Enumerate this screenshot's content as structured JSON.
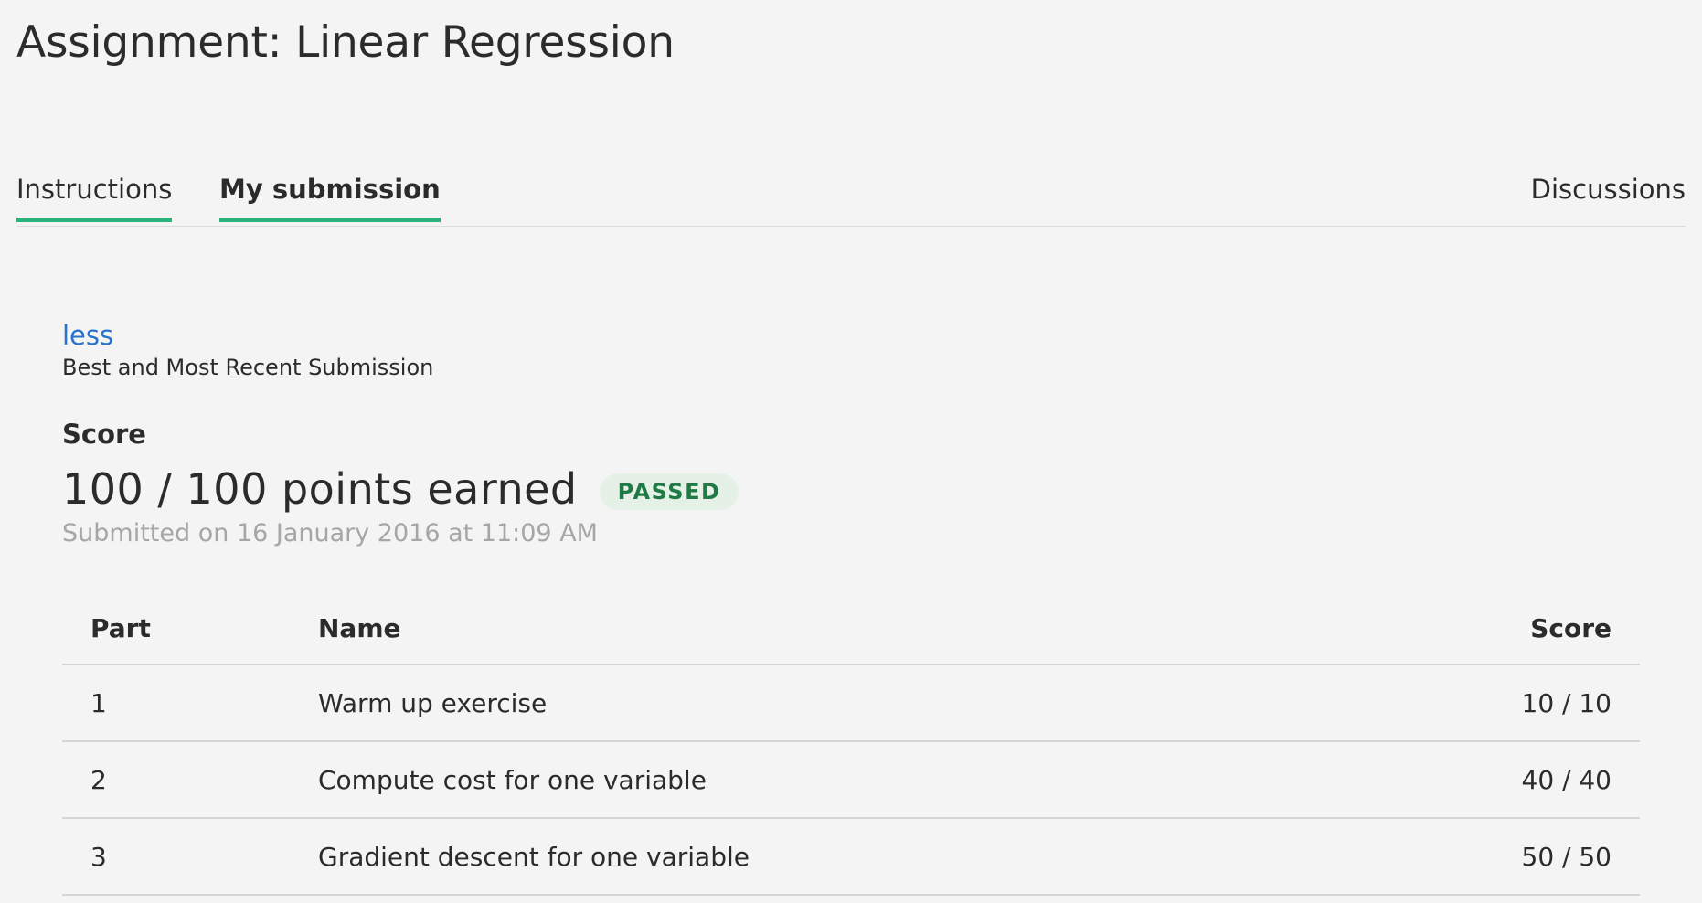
{
  "page": {
    "title": "Assignment: Linear Regression"
  },
  "tabs": [
    {
      "label": "Instructions"
    },
    {
      "label": "My submission"
    },
    {
      "label": "Discussions"
    }
  ],
  "submission": {
    "toggle_label": "less",
    "caption": "Best and Most Recent Submission",
    "score_heading": "Score",
    "points_earned": "100 / 100 points earned",
    "status": "PASSED",
    "submitted_on": "Submitted on 16 January 2016 at 11:09 AM"
  },
  "table": {
    "headers": {
      "part": "Part",
      "name": "Name",
      "score": "Score"
    },
    "rows": [
      {
        "part": "1",
        "name": "Warm up exercise",
        "score": "10 / 10"
      },
      {
        "part": "2",
        "name": "Compute cost for one variable",
        "score": "40 / 40"
      },
      {
        "part": "3",
        "name": "Gradient descent for one variable",
        "score": "50 / 50"
      }
    ]
  },
  "colors": {
    "tab_underline": "#2ab27b",
    "link": "#2a73cc",
    "passed_badge_bg": "#e5f1e6",
    "passed_badge_text": "#1f7a45"
  }
}
